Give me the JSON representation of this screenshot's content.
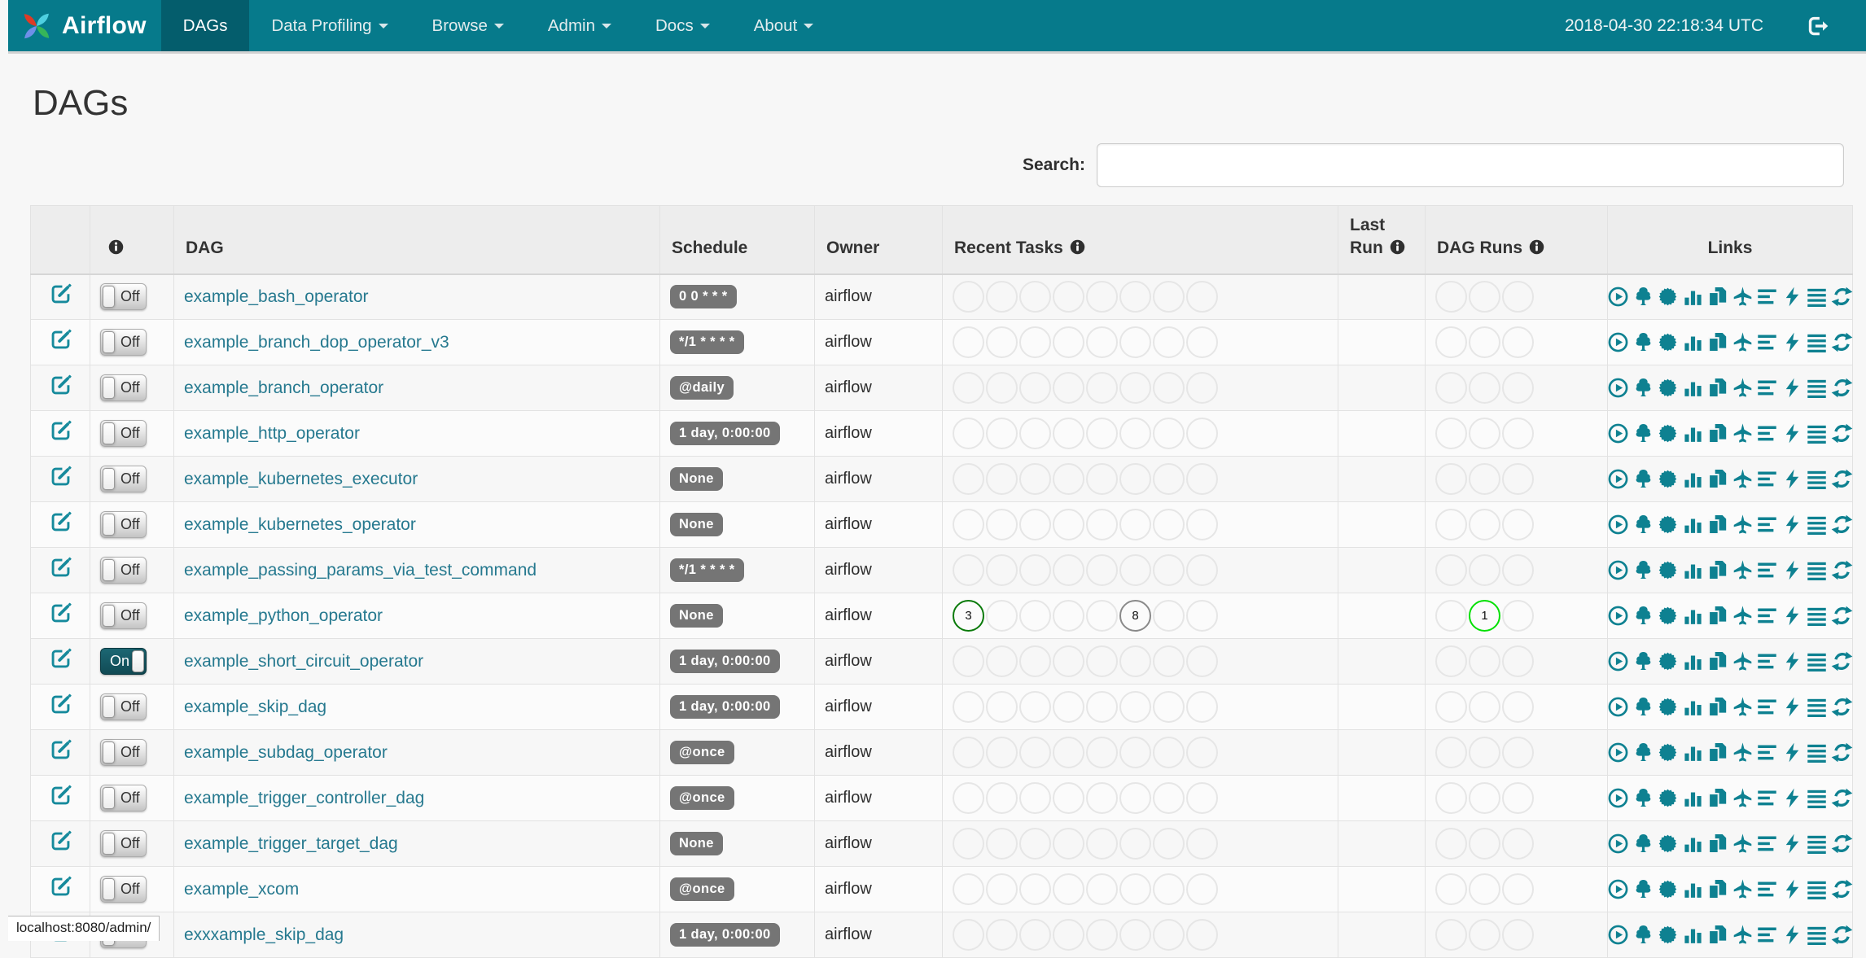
{
  "navbar": {
    "brand": "Airflow",
    "menu": [
      {
        "label": "DAGs",
        "active": true,
        "caret": false
      },
      {
        "label": "Data Profiling",
        "active": false,
        "caret": true
      },
      {
        "label": "Browse",
        "active": false,
        "caret": true
      },
      {
        "label": "Admin",
        "active": false,
        "caret": true
      },
      {
        "label": "Docs",
        "active": false,
        "caret": true
      },
      {
        "label": "About",
        "active": false,
        "caret": true
      }
    ],
    "clock": "2018-04-30 22:18:34 UTC"
  },
  "page": {
    "title": "DAGs",
    "search_label": "Search:",
    "search_value": ""
  },
  "table": {
    "headers": {
      "dag": "DAG",
      "schedule": "Schedule",
      "owner": "Owner",
      "recent_tasks": "Recent Tasks",
      "last_run": "Last Run",
      "dag_runs": "DAG Runs",
      "links": "Links"
    },
    "recent_slots": 8,
    "dag_run_slots": 3,
    "link_icons": [
      "trigger-dag-icon",
      "tree-view-icon",
      "graph-view-icon",
      "task-duration-icon",
      "task-tries-icon",
      "landing-times-icon",
      "gantt-view-icon",
      "code-view-icon",
      "logs-icon",
      "refresh-icon"
    ],
    "link_titles": [
      "Trigger Dag",
      "Tree View",
      "Graph View",
      "Task Duration",
      "Task Tries",
      "Landing Times",
      "Gantt View",
      "Code View",
      "Logs",
      "Refresh"
    ],
    "rows": [
      {
        "dag_id": "example_bash_operator",
        "enabled": false,
        "toggle": "Off",
        "schedule": "0 0 * * *",
        "owner": "airflow",
        "last_run": "",
        "recent_tasks": [],
        "dag_runs": []
      },
      {
        "dag_id": "example_branch_dop_operator_v3",
        "enabled": false,
        "toggle": "Off",
        "schedule": "*/1 * * * *",
        "owner": "airflow",
        "last_run": "",
        "recent_tasks": [],
        "dag_runs": []
      },
      {
        "dag_id": "example_branch_operator",
        "enabled": false,
        "toggle": "Off",
        "schedule": "@daily",
        "owner": "airflow",
        "last_run": "",
        "recent_tasks": [],
        "dag_runs": []
      },
      {
        "dag_id": "example_http_operator",
        "enabled": false,
        "toggle": "Off",
        "schedule": "1 day, 0:00:00",
        "owner": "airflow",
        "last_run": "",
        "recent_tasks": [],
        "dag_runs": []
      },
      {
        "dag_id": "example_kubernetes_executor",
        "enabled": false,
        "toggle": "Off",
        "schedule": "None",
        "owner": "airflow",
        "last_run": "",
        "recent_tasks": [],
        "dag_runs": []
      },
      {
        "dag_id": "example_kubernetes_operator",
        "enabled": false,
        "toggle": "Off",
        "schedule": "None",
        "owner": "airflow",
        "last_run": "",
        "recent_tasks": [],
        "dag_runs": []
      },
      {
        "dag_id": "example_passing_params_via_test_command",
        "enabled": false,
        "toggle": "Off",
        "schedule": "*/1 * * * *",
        "owner": "airflow",
        "last_run": "",
        "recent_tasks": [],
        "dag_runs": []
      },
      {
        "dag_id": "example_python_operator",
        "enabled": false,
        "toggle": "Off",
        "schedule": "None",
        "owner": "airflow",
        "last_run": "",
        "recent_tasks": [
          {
            "slot": 0,
            "count": "3",
            "color": "#0a7a0a"
          },
          {
            "slot": 5,
            "count": "8",
            "color": "#8a8a8a"
          }
        ],
        "dag_runs": [
          {
            "slot": 1,
            "count": "1",
            "color": "#04e004"
          }
        ]
      },
      {
        "dag_id": "example_short_circuit_operator",
        "enabled": true,
        "toggle": "On",
        "schedule": "1 day, 0:00:00",
        "owner": "airflow",
        "last_run": "",
        "recent_tasks": [],
        "dag_runs": []
      },
      {
        "dag_id": "example_skip_dag",
        "enabled": false,
        "toggle": "Off",
        "schedule": "1 day, 0:00:00",
        "owner": "airflow",
        "last_run": "",
        "recent_tasks": [],
        "dag_runs": []
      },
      {
        "dag_id": "example_subdag_operator",
        "enabled": false,
        "toggle": "Off",
        "schedule": "@once",
        "owner": "airflow",
        "last_run": "",
        "recent_tasks": [],
        "dag_runs": []
      },
      {
        "dag_id": "example_trigger_controller_dag",
        "enabled": false,
        "toggle": "Off",
        "schedule": "@once",
        "owner": "airflow",
        "last_run": "",
        "recent_tasks": [],
        "dag_runs": []
      },
      {
        "dag_id": "example_trigger_target_dag",
        "enabled": false,
        "toggle": "Off",
        "schedule": "None",
        "owner": "airflow",
        "last_run": "",
        "recent_tasks": [],
        "dag_runs": []
      },
      {
        "dag_id": "example_xcom",
        "enabled": false,
        "toggle": "Off",
        "schedule": "@once",
        "owner": "airflow",
        "last_run": "",
        "recent_tasks": [],
        "dag_runs": []
      },
      {
        "dag_id": "exxxample_skip_dag",
        "enabled": false,
        "toggle": "Off",
        "schedule": "1 day, 0:00:00",
        "owner": "airflow",
        "last_run": "",
        "recent_tasks": [],
        "dag_runs": []
      }
    ]
  },
  "status_bar": {
    "text": "localhost:8080/admin/"
  },
  "colors": {
    "navbar": "#067a8b",
    "navbar_active": "#045d6c",
    "link": "#26798f",
    "icon_teal": "#0e8191",
    "badge_bg": "#757575",
    "task_success": "#0a7a0a",
    "task_queued_gray": "#8a8a8a",
    "dagrun_running": "#04e004"
  }
}
